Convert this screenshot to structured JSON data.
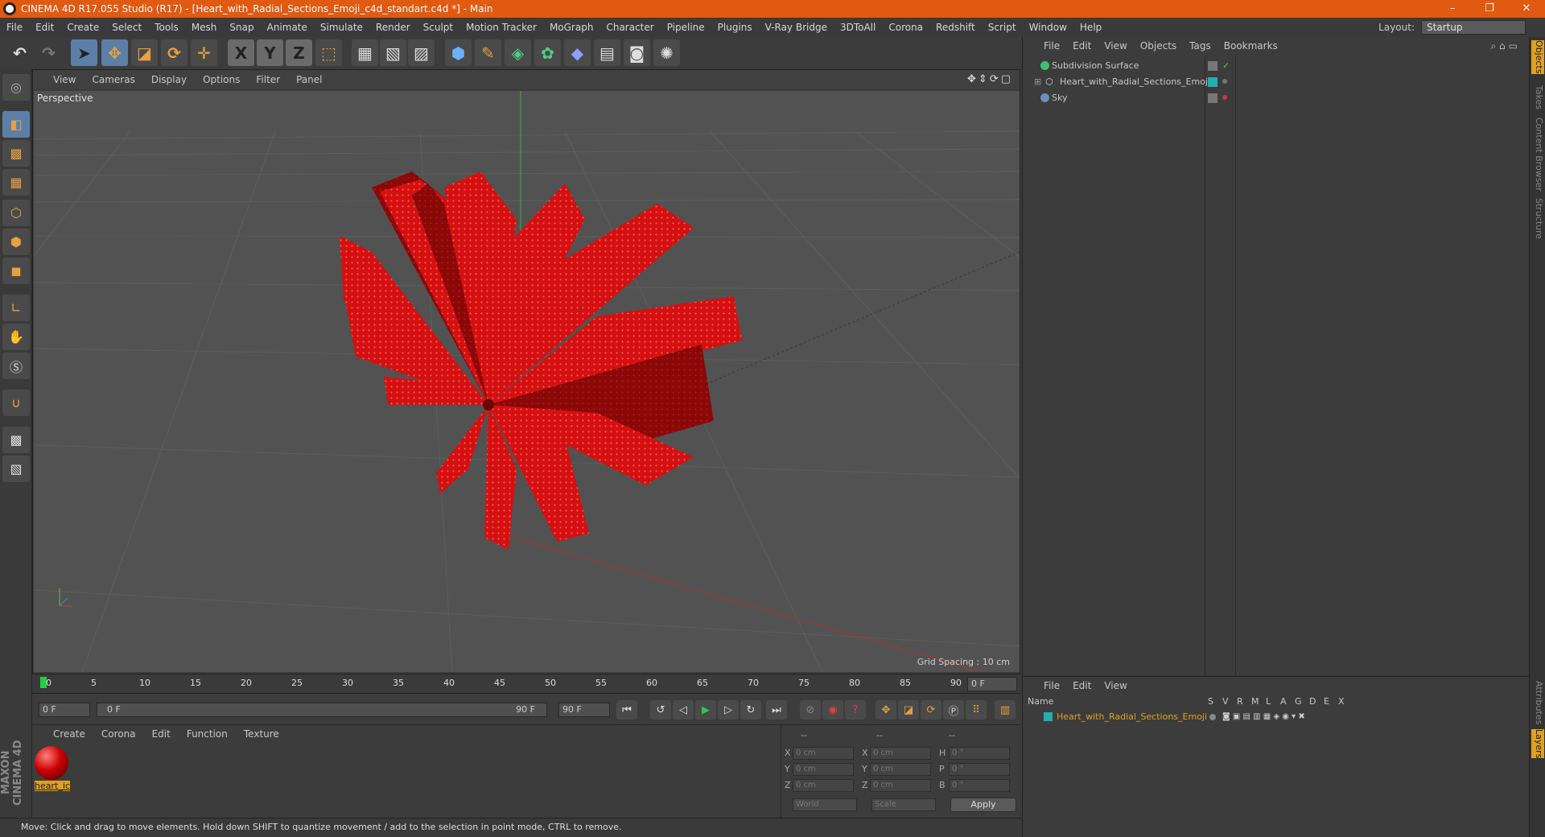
{
  "window": {
    "title": "CINEMA 4D R17.055 Studio (R17) - [Heart_with_Radial_Sections_Emoji_c4d_standart.c4d *] - Main",
    "controls": [
      "–",
      "❐",
      "✕"
    ]
  },
  "menubar": [
    "File",
    "Edit",
    "Create",
    "Select",
    "Tools",
    "Mesh",
    "Snap",
    "Animate",
    "Simulate",
    "Render",
    "Sculpt",
    "Motion Tracker",
    "MoGraph",
    "Character",
    "Pipeline",
    "Plugins",
    "V-Ray Bridge",
    "3DToAll",
    "Corona",
    "Redshift",
    "Script",
    "Window",
    "Help"
  ],
  "layout": {
    "label": "Layout:",
    "value": "Startup"
  },
  "toolbar": {
    "x": "X",
    "y": "Y",
    "z": "Z"
  },
  "viewport": {
    "menu": [
      "View",
      "Cameras",
      "Display",
      "Options",
      "Filter",
      "Panel"
    ],
    "label": "Perspective",
    "grid_spacing": "Grid Spacing : 10 cm",
    "nav_icons": "✥⇕⟳▢"
  },
  "timeline": {
    "ticks": [
      "0",
      "5",
      "10",
      "15",
      "20",
      "25",
      "30",
      "35",
      "40",
      "45",
      "50",
      "55",
      "60",
      "65",
      "70",
      "75",
      "80",
      "85",
      "90"
    ],
    "current": "0 F",
    "start": "0 F",
    "range_start": "0 F",
    "range_end": "90 F",
    "end": "90 F"
  },
  "material_manager": {
    "menu": [
      "Create",
      "Corona",
      "Edit",
      "Function",
      "Texture"
    ],
    "materials": [
      {
        "name": "heart_ic"
      }
    ]
  },
  "coordinates": {
    "headers": [
      "--",
      "--",
      "--"
    ],
    "rows": [
      {
        "a": "X",
        "av": "0 cm",
        "b": "X",
        "bv": "0 cm",
        "c": "H",
        "cv": "0 °"
      },
      {
        "a": "Y",
        "av": "0 cm",
        "b": "Y",
        "bv": "0 cm",
        "c": "P",
        "cv": "0 °"
      },
      {
        "a": "Z",
        "av": "0 cm",
        "b": "Z",
        "bv": "0 cm",
        "c": "B",
        "cv": "0 °"
      }
    ],
    "mode": "World",
    "scale": "Scale",
    "apply": "Apply"
  },
  "object_manager": {
    "menu": [
      "File",
      "Edit",
      "View",
      "Objects",
      "Tags",
      "Bookmarks"
    ],
    "objects": [
      {
        "name": "Subdivision Surface",
        "color": "#c8c8c8"
      },
      {
        "name": "Heart_with_Radial_Sections_Emoji",
        "color": "#c8c8c8"
      },
      {
        "name": "Sky",
        "color": "#c8c8c8"
      }
    ]
  },
  "layer_manager": {
    "menu": [
      "File",
      "Edit",
      "View"
    ],
    "name_header": "Name",
    "columns": [
      "S",
      "V",
      "R",
      "M",
      "L",
      "A",
      "G",
      "D",
      "E",
      "X"
    ],
    "layers": [
      {
        "name": "Heart_with_Radial_Sections_Emoji",
        "color": "#e0a020"
      }
    ]
  },
  "side_tabs": [
    "Objects",
    "Takes",
    "Content Browser",
    "Structure",
    "Attributes",
    "Layers"
  ],
  "status": "Move: Click and drag to move elements. Hold down SHIFT to quantize movement / add to the selection in point mode, CTRL to remove.",
  "branding": "MAXON CINEMA 4D",
  "colors": {
    "accent": "#e05a12",
    "selection": "#5c7fa8",
    "highlight": "#e0a020",
    "object_red": "#d41010"
  }
}
